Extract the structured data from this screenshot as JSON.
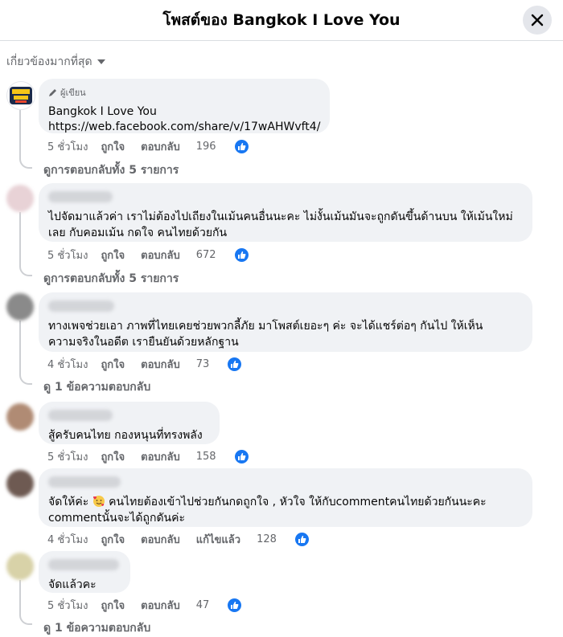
{
  "header": {
    "title": "โพสต์ของ Bangkok I Love You"
  },
  "sort": {
    "label": "เกี่ยวข้องมากที่สุด"
  },
  "colors": {
    "like_blue": "#1877f2",
    "bubble_bg": "#f0f2f5",
    "meta_gray": "#65676b"
  },
  "actions": {
    "like": "ถูกใจ",
    "reply": "ตอบกลับ",
    "edited": "แก้ไขแล้ว"
  },
  "comments": [
    {
      "author_badge": "ผู้เขียน",
      "line1": "Bangkok I Love You",
      "line2": "https://web.facebook.com/share/v/17wAHWvft4/",
      "time": "5 ชั่วโมง",
      "reactions": "196",
      "replies_label": "ดูการตอบกลับทั้ง 5 รายการ"
    },
    {
      "line1": "ไปจัดมาแล้วค่า เราไม่ต้องไปเถียงในเม้นคนอื่นนะคะ ไม่งั้นเม้นมันจะถูกดันขึ้นด้านบน ให้เม้นใหม่",
      "line2": "เลย กับคอมเม้น กดใจ คนไทยด้วยกัน",
      "time": "5 ชั่วโมง",
      "reactions": "672",
      "replies_label": "ดูการตอบกลับทั้ง 5 รายการ"
    },
    {
      "line1": "ทางเพจช่วยเอา ภาพที่ไทยเคยช่วยพวกลี้ภัย มาโพสต์เยอะๆ ค่ะ จะได้แชร์ต่อๆ กันไป ให้เห็น",
      "line2": "ความจริงในอดีต เรายืนยันด้วยหลักฐาน",
      "time": "4 ชั่วโมง",
      "reactions": "73",
      "replies_label": "ดู 1 ข้อความตอบกลับ"
    },
    {
      "line1": "สู้ครับคนไทย กองหนุนที่ทรงพลัง",
      "time": "5 ชั่วโมง",
      "reactions": "158"
    },
    {
      "line1a": "จัดให้ค่ะ",
      "line1b": " คนไทยต้องเข้าไปช่วยกันกดถูกใจ , หัวใจ ให้กับcommentคนไทยด้วยกันนะคะ",
      "line2": "commentนั้นจะได้ถูกดันค่ะ",
      "time": "4 ชั่วโมง",
      "reactions": "128"
    },
    {
      "line1": "จัดแล้วคะ",
      "time": "5 ชั่วโมง",
      "reactions": "47",
      "replies_label": "ดู 1 ข้อความตอบกลับ"
    }
  ]
}
